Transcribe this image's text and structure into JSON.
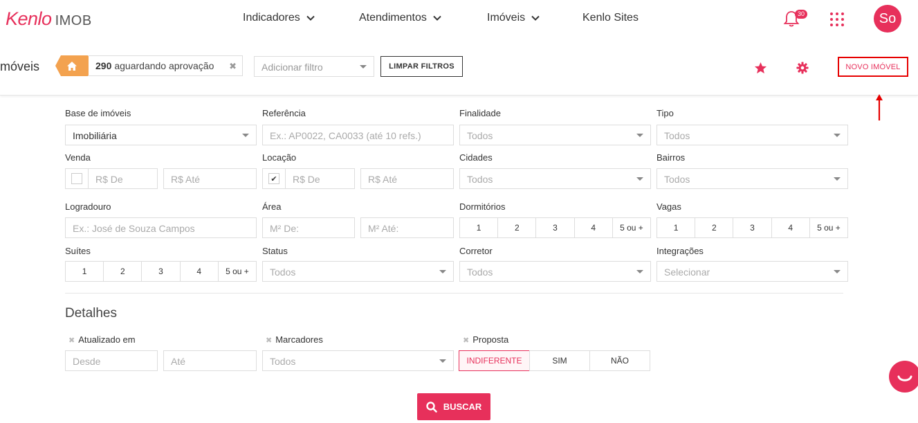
{
  "nav": {
    "brand": "Kenlo",
    "product": "IMOB",
    "items": [
      "Indicadores",
      "Atendimentos",
      "Imóveis",
      "Kenlo Sites"
    ],
    "notifications": "30",
    "avatar": "So"
  },
  "toolbar": {
    "title": "móveis",
    "chip_count": "290",
    "chip_text": "aguardando aprovação",
    "filter_placeholder": "Adicionar filtro",
    "clear_label": "LIMPAR FILTROS",
    "new_label": "NOVO IMÓVEL"
  },
  "form": {
    "base_label": "Base de imóveis",
    "base_value": "Imobiliária",
    "ref_label": "Referência",
    "ref_placeholder": "Ex.: AP0022, CA0033 (até 10 refs.)",
    "finalidade_label": "Finalidade",
    "finalidade_value": "Todos",
    "tipo_label": "Tipo",
    "tipo_value": "Todos",
    "venda_label": "Venda",
    "venda_de": "R$ De",
    "venda_ate": "R$ Até",
    "locacao_label": "Locação",
    "locacao_de": "R$ De",
    "locacao_ate": "R$ Até",
    "cidades_label": "Cidades",
    "cidades_value": "Todos",
    "bairros_label": "Bairros",
    "bairros_value": "Todos",
    "logradouro_label": "Logradouro",
    "logradouro_placeholder": "Ex.: José de Souza Campos",
    "area_label": "Área",
    "area_de": "M² De:",
    "area_ate": "M² Até:",
    "dormitorios_label": "Dormitórios",
    "vagas_label": "Vagas",
    "suites_label": "Suítes",
    "counts": [
      "1",
      "2",
      "3",
      "4",
      "5 ou +"
    ],
    "status_label": "Status",
    "status_value": "Todos",
    "corretor_label": "Corretor",
    "corretor_value": "Todos",
    "integracoes_label": "Integrações",
    "integracoes_value": "Selecionar"
  },
  "details": {
    "title": "Detalhes",
    "atualizado_label": "Atualizado em",
    "desde": "Desde",
    "ate": "Até",
    "marcadores_label": "Marcadores",
    "marcadores_value": "Todos",
    "proposta_label": "Proposta",
    "proposta_options": [
      "INDIFERENTE",
      "SIM",
      "NÃO"
    ]
  },
  "search_label": "BUSCAR",
  "colors": {
    "brand": "#e7305b",
    "home_tag": "#f3a24f",
    "annotation": "#e60000"
  },
  "icons": [
    "chevron-down-icon",
    "bell-icon",
    "apps-grid-icon",
    "home-icon",
    "close-icon",
    "star-icon",
    "gear-icon",
    "search-icon",
    "chat-icon"
  ]
}
